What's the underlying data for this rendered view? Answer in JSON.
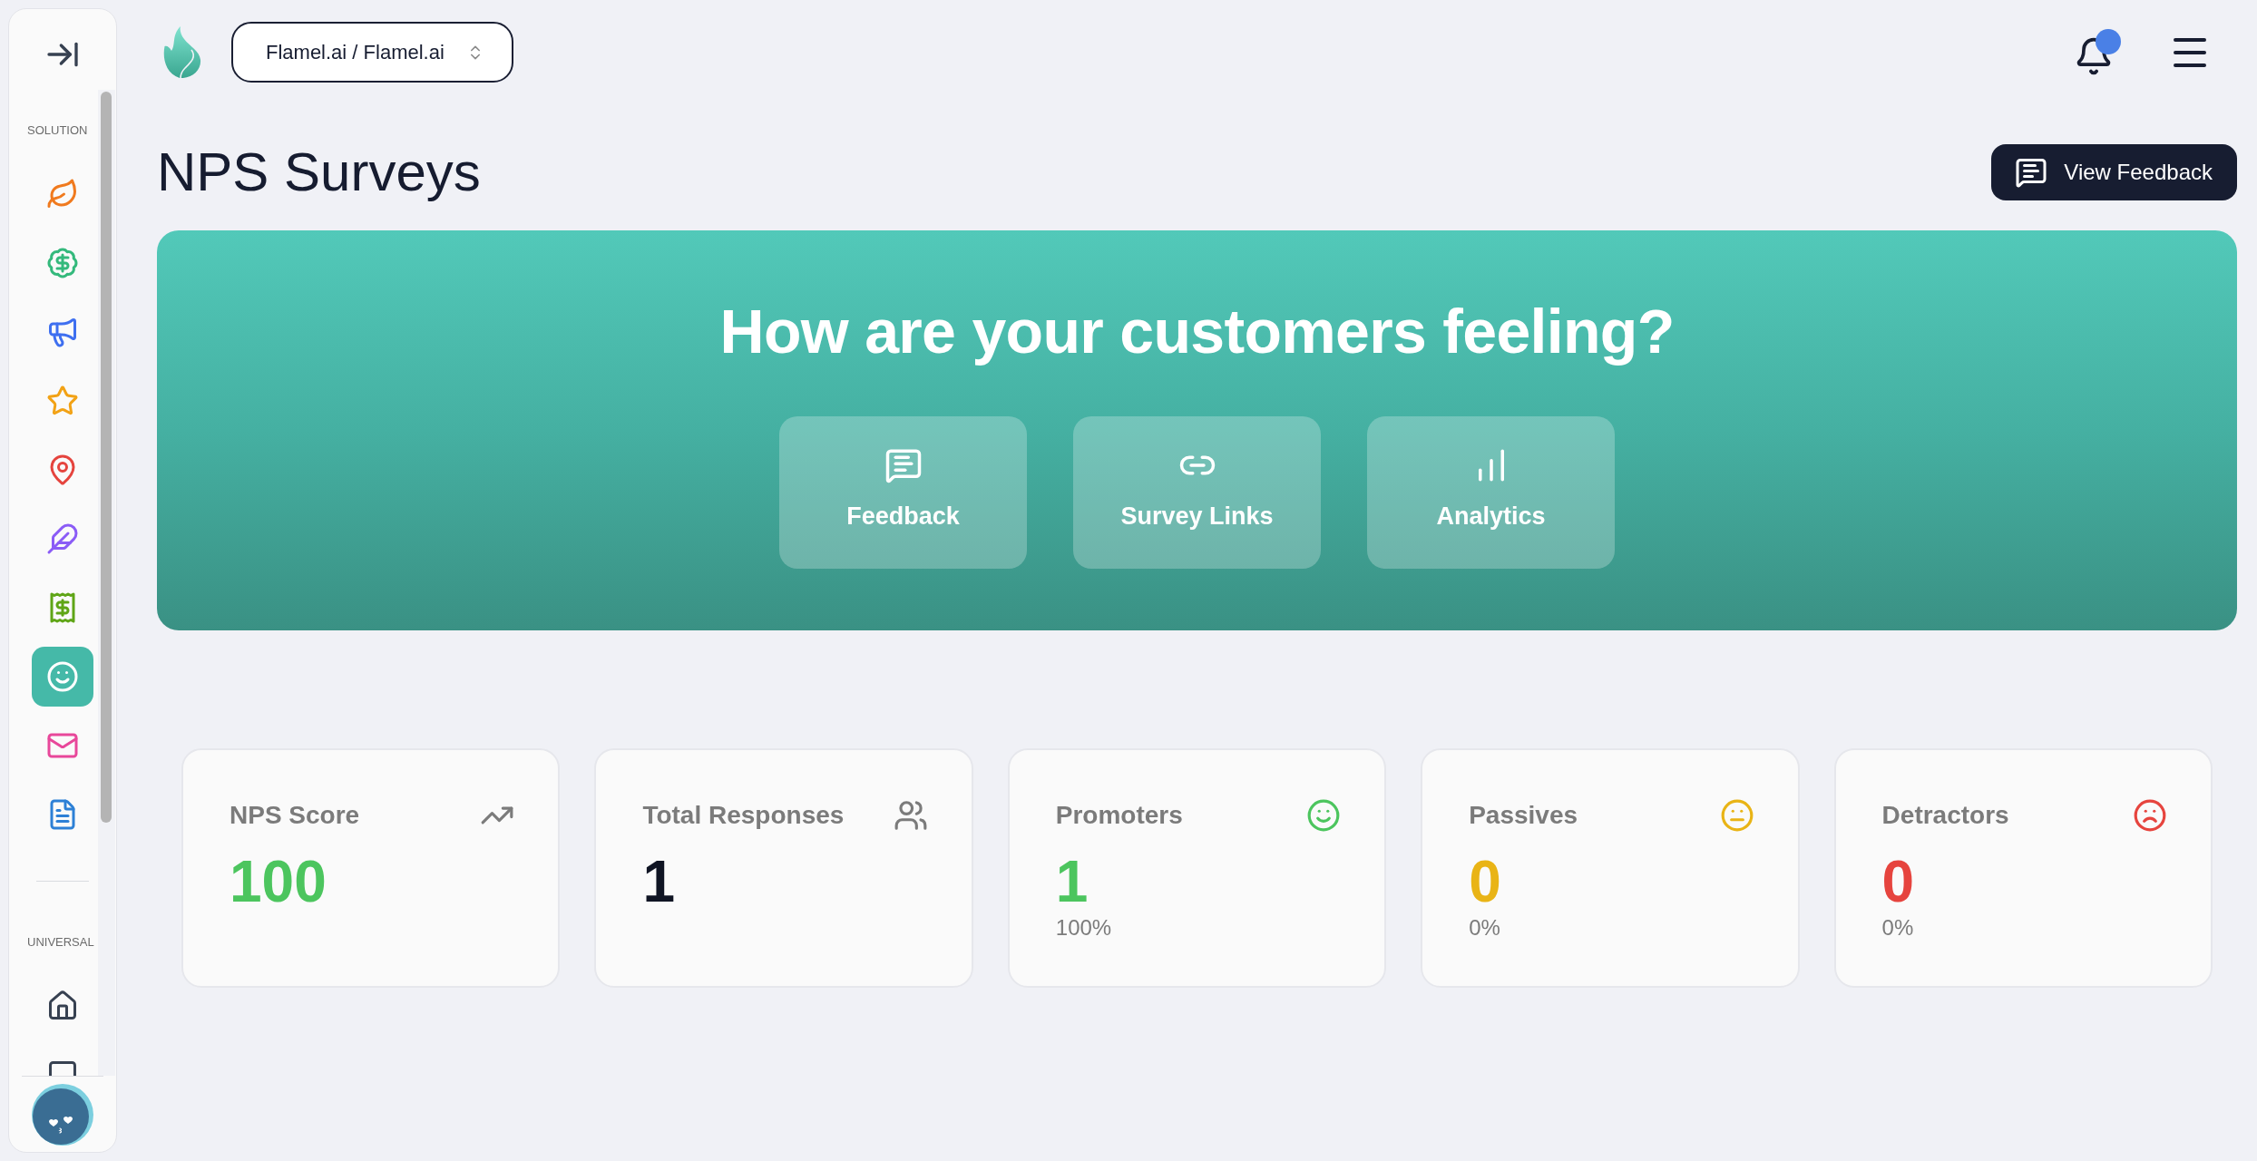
{
  "sidebar": {
    "sections": [
      {
        "label": "SOLUTION",
        "items": [
          {
            "selected": false
          },
          {
            "selected": false
          },
          {
            "selected": false
          },
          {
            "selected": false
          },
          {
            "selected": false
          },
          {
            "selected": false
          },
          {
            "selected": false
          },
          {
            "selected": true
          },
          {
            "selected": false
          },
          {
            "selected": false
          }
        ]
      },
      {
        "label": "UNIVERSAL",
        "items": [
          {
            "selected": false
          },
          {
            "selected": false
          }
        ]
      }
    ]
  },
  "header": {
    "org_switcher": {
      "value": "Flamel.ai / Flamel.ai"
    },
    "notifications": {
      "unread": true
    }
  },
  "page": {
    "title": "NPS Surveys",
    "primary_action": {
      "label": "View Feedback"
    }
  },
  "hero": {
    "heading": "How are your customers feeling?",
    "actions": [
      {
        "label": "Feedback"
      },
      {
        "label": "Survey Links"
      },
      {
        "label": "Analytics"
      }
    ]
  },
  "stats": [
    {
      "label": "NPS Score",
      "value": "100",
      "color": "#4cc55e"
    },
    {
      "label": "Total Responses",
      "value": "1",
      "color": "#0f1423"
    },
    {
      "label": "Promoters",
      "value": "1",
      "share": "100%",
      "color": "#4cc55e"
    },
    {
      "label": "Passives",
      "value": "0",
      "share": "0%",
      "color": "#e9b416"
    },
    {
      "label": "Detractors",
      "value": "0",
      "share": "0%",
      "color": "#e6443e"
    }
  ]
}
